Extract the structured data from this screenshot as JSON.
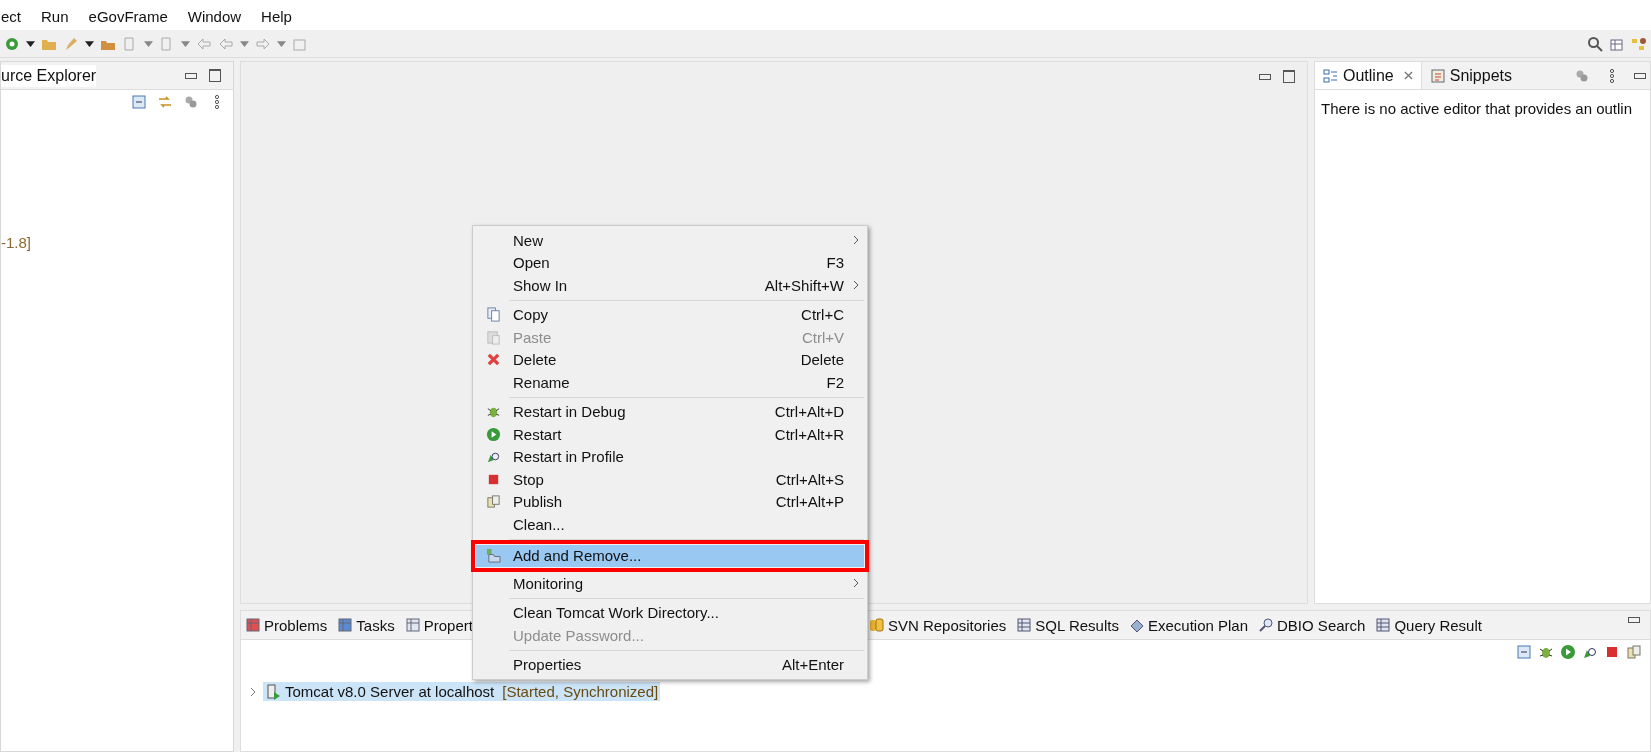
{
  "menu_bar": [
    {
      "label": "ect"
    },
    {
      "label": "Run"
    },
    {
      "label": "eGovFrame"
    },
    {
      "label": "Window"
    },
    {
      "label": "Help"
    }
  ],
  "left_panel": {
    "title": "urce Explorer",
    "tree_text": "-1.8]"
  },
  "right_panel": {
    "tabs": [
      {
        "label": "Outline",
        "selected": true
      },
      {
        "label": "Snippets",
        "selected": false
      }
    ],
    "message": "There is no active editor that provides an outlin"
  },
  "bottom_panel": {
    "tabs_left": [
      {
        "label": "Problems"
      },
      {
        "label": "Tasks"
      },
      {
        "label": "Propert"
      }
    ],
    "tabs_right": [
      {
        "label": "SVN Repositories"
      },
      {
        "label": "SQL Results"
      },
      {
        "label": "Execution Plan"
      },
      {
        "label": "DBIO Search"
      },
      {
        "label": "Query Result"
      }
    ],
    "server": {
      "name": "Tomcat v8.0 Server at localhost",
      "status": "[Started, Synchronized]",
      "selected": true,
      "expanded": false
    }
  },
  "context_menu": [
    {
      "kind": "item",
      "label": "New",
      "submenu": true,
      "disabled": false,
      "selected": false
    },
    {
      "kind": "item",
      "label": "Open",
      "shortcut": "F3",
      "submenu": false,
      "disabled": false,
      "selected": false
    },
    {
      "kind": "item",
      "label": "Show In",
      "shortcut": "Alt+Shift+W",
      "submenu": true,
      "disabled": false,
      "selected": false
    },
    {
      "kind": "separator"
    },
    {
      "kind": "item",
      "label": "Copy",
      "shortcut": "Ctrl+C",
      "submenu": false,
      "disabled": false,
      "selected": false
    },
    {
      "kind": "item",
      "label": "Paste",
      "shortcut": "Ctrl+V",
      "submenu": false,
      "disabled": true,
      "selected": false
    },
    {
      "kind": "item",
      "label": "Delete",
      "shortcut": "Delete",
      "submenu": false,
      "disabled": false,
      "selected": false
    },
    {
      "kind": "item",
      "label": "Rename",
      "shortcut": "F2",
      "submenu": false,
      "disabled": false,
      "selected": false
    },
    {
      "kind": "separator"
    },
    {
      "kind": "item",
      "label": "Restart in Debug",
      "shortcut": "Ctrl+Alt+D",
      "submenu": false,
      "disabled": false,
      "selected": false
    },
    {
      "kind": "item",
      "label": "Restart",
      "shortcut": "Ctrl+Alt+R",
      "submenu": false,
      "disabled": false,
      "selected": false
    },
    {
      "kind": "item",
      "label": "Restart in Profile",
      "submenu": false,
      "disabled": false,
      "selected": false
    },
    {
      "kind": "item",
      "label": "Stop",
      "shortcut": "Ctrl+Alt+S",
      "submenu": false,
      "disabled": false,
      "selected": false
    },
    {
      "kind": "item",
      "label": "Publish",
      "shortcut": "Ctrl+Alt+P",
      "submenu": false,
      "disabled": false,
      "selected": false
    },
    {
      "kind": "item",
      "label": "Clean...",
      "submenu": false,
      "disabled": false,
      "selected": false
    },
    {
      "kind": "separator"
    },
    {
      "kind": "item",
      "label": "Add and Remove...",
      "submenu": false,
      "disabled": false,
      "selected": true
    },
    {
      "kind": "item",
      "label": "Monitoring",
      "submenu": true,
      "disabled": false,
      "selected": false
    },
    {
      "kind": "separator"
    },
    {
      "kind": "item",
      "label": "Clean Tomcat Work Directory...",
      "submenu": false,
      "disabled": false,
      "selected": false
    },
    {
      "kind": "item",
      "label": "Update Password...",
      "submenu": false,
      "disabled": true,
      "selected": false
    },
    {
      "kind": "separator"
    },
    {
      "kind": "item",
      "label": "Properties",
      "shortcut": "Alt+Enter",
      "submenu": false,
      "disabled": false,
      "selected": false
    }
  ]
}
